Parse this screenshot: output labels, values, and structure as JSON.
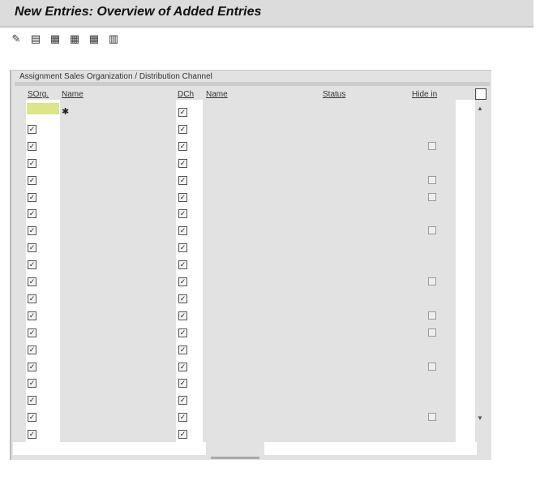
{
  "title": "New Entries: Overview of Added Entries",
  "toolbar": [
    "change-display-icon",
    "save-icon",
    "select-all-icon",
    "select-block-icon",
    "deselect-all-icon",
    "config-icon"
  ],
  "panel_title": "Assignment Sales Organization / Distribution Channel",
  "columns": {
    "sorg": "SOrg.",
    "name1": "Name",
    "dch": "DCh",
    "name2": "Name",
    "status": "Status",
    "hide": "Hide in"
  },
  "rows": [
    {
      "sorg_checked": false,
      "dch_checked": true,
      "hide": false
    },
    {
      "sorg_checked": true,
      "dch_checked": true,
      "hide": false
    },
    {
      "sorg_checked": true,
      "dch_checked": true,
      "hide": true
    },
    {
      "sorg_checked": true,
      "dch_checked": true,
      "hide": false
    },
    {
      "sorg_checked": true,
      "dch_checked": true,
      "hide": true
    },
    {
      "sorg_checked": true,
      "dch_checked": true,
      "hide": true
    },
    {
      "sorg_checked": true,
      "dch_checked": true,
      "hide": false
    },
    {
      "sorg_checked": true,
      "dch_checked": true,
      "hide": true
    },
    {
      "sorg_checked": true,
      "dch_checked": true,
      "hide": false
    },
    {
      "sorg_checked": true,
      "dch_checked": true,
      "hide": false
    },
    {
      "sorg_checked": true,
      "dch_checked": true,
      "hide": true
    },
    {
      "sorg_checked": true,
      "dch_checked": true,
      "hide": false
    },
    {
      "sorg_checked": true,
      "dch_checked": true,
      "hide": true
    },
    {
      "sorg_checked": true,
      "dch_checked": true,
      "hide": true
    },
    {
      "sorg_checked": true,
      "dch_checked": true,
      "hide": false
    },
    {
      "sorg_checked": true,
      "dch_checked": true,
      "hide": true
    },
    {
      "sorg_checked": true,
      "dch_checked": true,
      "hide": false
    },
    {
      "sorg_checked": true,
      "dch_checked": true,
      "hide": false
    },
    {
      "sorg_checked": true,
      "dch_checked": true,
      "hide": true
    },
    {
      "sorg_checked": true,
      "dch_checked": true,
      "hide": false
    }
  ],
  "colors": {
    "focus": "#dde58a",
    "bg": "#e2e2e2"
  }
}
